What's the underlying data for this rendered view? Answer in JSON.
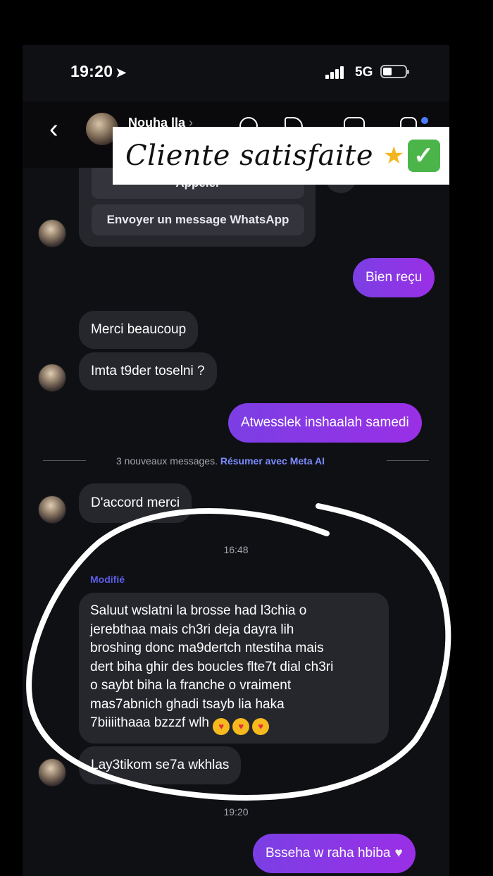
{
  "status_bar": {
    "time": "19:20",
    "network": "5G"
  },
  "header": {
    "contact_name": "Nouha lla",
    "chevron": "›"
  },
  "overlay": {
    "text": "Cliente satisfaite",
    "star_icon": "star-emoji",
    "check_icon": "check-emoji"
  },
  "card": {
    "call_label": "Appeler",
    "whatsapp_label": "Envoyer un message WhatsApp"
  },
  "messages": {
    "m1_out": "Bien reçu",
    "m2_in": "Merci beaucoup",
    "m3_in": "Imta t9der toselni ?",
    "m4_out": "Atwesslek inshaalah samedi",
    "m5_in": "D'accord merci",
    "m6_in_lines": [
      "Saluut wslatni la brosse had l3chia o",
      "jerebthaa mais ch3ri deja dayra lih",
      "broshing donc ma9dertch ntestiha mais",
      "dert biha ghir des boucles flte7t dial ch3ri",
      "o saybt biha la franche o vraiment",
      "mas7abnich ghadi tsayb lia haka",
      "7biiiithaaa bzzzf wlh"
    ],
    "m7_in": "Lay3tikom se7a wkhlas",
    "m8_out": "Bsseha w raha hbiba"
  },
  "divider": {
    "text": "3 nouveaux messages.",
    "link": "Résumer avec Meta AI"
  },
  "timestamps": {
    "t1": "16:48",
    "t2": "19:20"
  },
  "modified_label": "Modifié"
}
